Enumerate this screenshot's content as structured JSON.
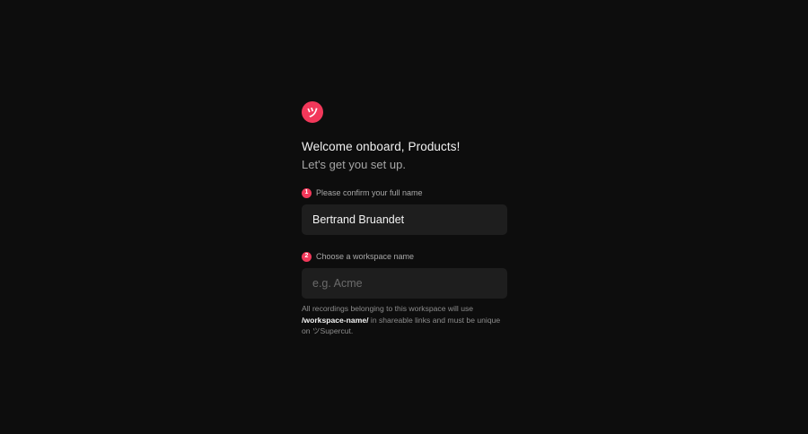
{
  "brand": {
    "logo_glyph": "ツ",
    "accent": "#f2385a",
    "icon": "supercut-logo-icon"
  },
  "header": {
    "title": "Welcome onboard, Products!",
    "subtitle": "Let's get you set up."
  },
  "steps": [
    {
      "number": "1",
      "label": "Please confirm your full name",
      "value": "Bertrand Bruandet",
      "placeholder": ""
    },
    {
      "number": "2",
      "label": "Choose a workspace name",
      "value": "",
      "placeholder": "e.g. Acme"
    }
  ],
  "help": {
    "part1": "All recordings belonging to this workspace will use ",
    "path": "/workspace-name/",
    "part2": " in shareable links and must be unique on ツSupercut."
  }
}
